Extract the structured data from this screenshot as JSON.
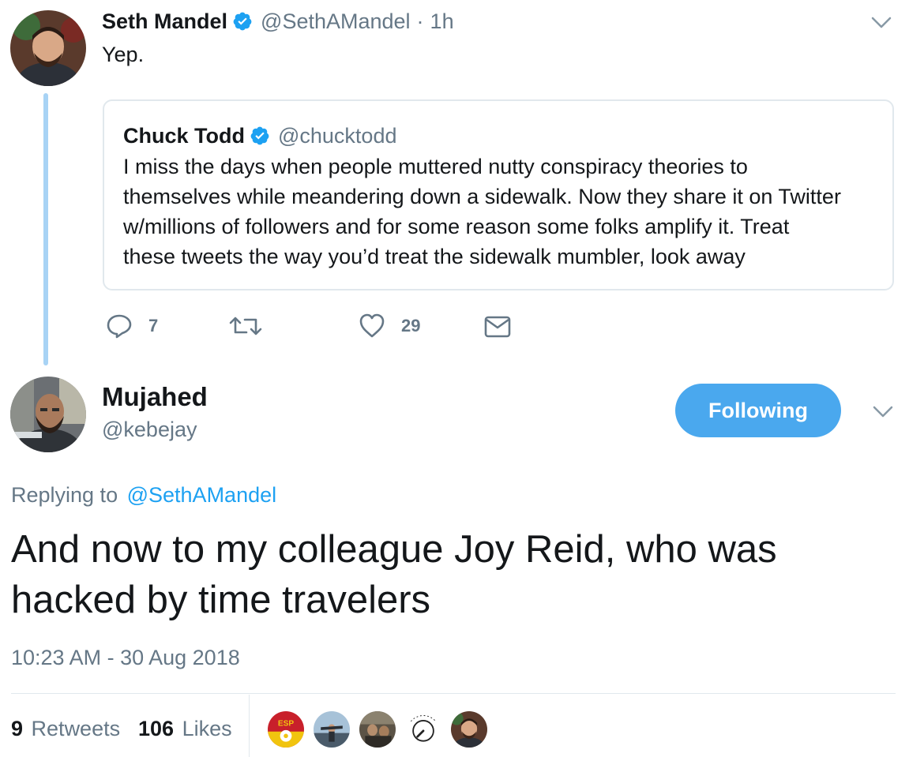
{
  "parent_tweet": {
    "name": "Seth Mandel",
    "handle": "@SethAMandel",
    "separator": "·",
    "time": "1h",
    "text": "Yep.",
    "quoted": {
      "name": "Chuck Todd",
      "handle": "@chucktodd",
      "lines": [
        "I miss the days when people muttered nutty conspiracy theories to",
        "themselves while meandering down a sidewalk. Now they share it on Twitter",
        "w/millions of followers and for some reason some folks amplify it.  Treat",
        "these tweets the way you’d treat the sidewalk mumbler, look away"
      ]
    },
    "actions": {
      "reply_count": "7",
      "retweet_count": "",
      "like_count": "29"
    }
  },
  "main_tweet": {
    "name": "Mujahed",
    "handle": "@kebejay",
    "follow_label": "Following",
    "replying_prefix": "Replying to",
    "replying_to": "@SethAMandel",
    "text_lines": [
      "And now to my colleague Joy Reid, who was",
      "hacked by time travelers"
    ],
    "timestamp": "10:23 AM - 30 Aug 2018",
    "retweets_count": "9",
    "retweets_label": "Retweets",
    "likes_count": "106",
    "likes_label": "Likes",
    "mini_avatar_badge": "ESP"
  },
  "colors": {
    "accent": "#1da1f2",
    "button": "#4aa8ee",
    "thread_line": "#a8d3f5",
    "muted": "#657786",
    "border": "#e1e8ed"
  }
}
